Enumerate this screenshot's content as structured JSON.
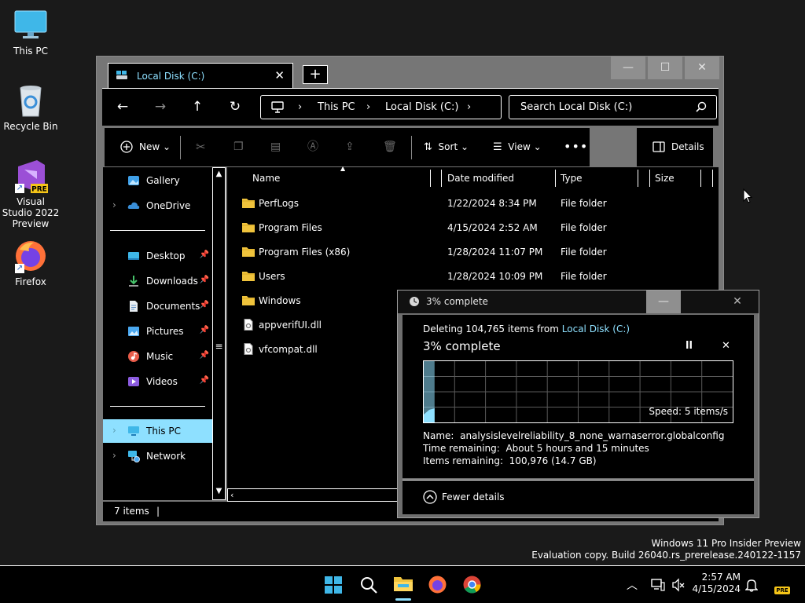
{
  "desktop": {
    "icons": [
      {
        "label": "This PC"
      },
      {
        "label": "Recycle Bin"
      },
      {
        "label": "Visual Studio 2022 Preview",
        "badge": "PRE"
      },
      {
        "label": "Firefox"
      }
    ]
  },
  "explorer": {
    "tab_title": "Local Disk (C:)",
    "breadcrumb": [
      "This PC",
      "Local Disk (C:)"
    ],
    "search_placeholder": "Search Local Disk (C:)",
    "commands": {
      "new": "New",
      "sort": "Sort",
      "view": "View",
      "details": "Details"
    },
    "nav": [
      {
        "label": "Gallery"
      },
      {
        "label": "OneDrive"
      },
      {
        "label": "Desktop"
      },
      {
        "label": "Downloads"
      },
      {
        "label": "Documents"
      },
      {
        "label": "Pictures"
      },
      {
        "label": "Music"
      },
      {
        "label": "Videos"
      },
      {
        "label": "This PC"
      },
      {
        "label": "Network"
      }
    ],
    "columns": [
      "Name",
      "Date modified",
      "Type",
      "Size"
    ],
    "files": [
      {
        "name": "PerfLogs",
        "date": "1/22/2024 8:34 PM",
        "type": "File folder"
      },
      {
        "name": "Program Files",
        "date": "4/15/2024 2:52 AM",
        "type": "File folder"
      },
      {
        "name": "Program Files (x86)",
        "date": "1/28/2024 11:07 PM",
        "type": "File folder"
      },
      {
        "name": "Users",
        "date": "1/28/2024 10:09 PM",
        "type": "File folder"
      },
      {
        "name": "Windows",
        "date": "",
        "type": ""
      },
      {
        "name": "appverifUI.dll",
        "date": "",
        "type": ""
      },
      {
        "name": "vfcompat.dll",
        "date": "",
        "type": ""
      }
    ],
    "status": "7 items"
  },
  "progress": {
    "title": "3% complete",
    "deleting_prefix": "Deleting 104,765 items from ",
    "deleting_link": "Local Disk (C:)",
    "heading": "3% complete",
    "percent": 3,
    "speed": "Speed: 5 items/s",
    "name_label": "Name:",
    "name_value": "analysislevelreliability_8_none_warnaserror.globalconfig",
    "time_label": "Time remaining:",
    "time_value": "About 5 hours and 15 minutes",
    "items_label": "Items remaining:",
    "items_value": "100,976 (14.7 GB)",
    "fewer": "Fewer details"
  },
  "watermark": {
    "line1": "Windows 11 Pro Insider Preview",
    "line2": "Evaluation copy. Build 26040.rs_prerelease.240122-1157"
  },
  "taskbar": {
    "time": "2:57 AM",
    "date": "4/15/2024",
    "pre_badge": "PRE"
  },
  "colors": {
    "accent": "#8ee0ff",
    "folder": "#f0c33c",
    "window_gray": "#767676"
  }
}
